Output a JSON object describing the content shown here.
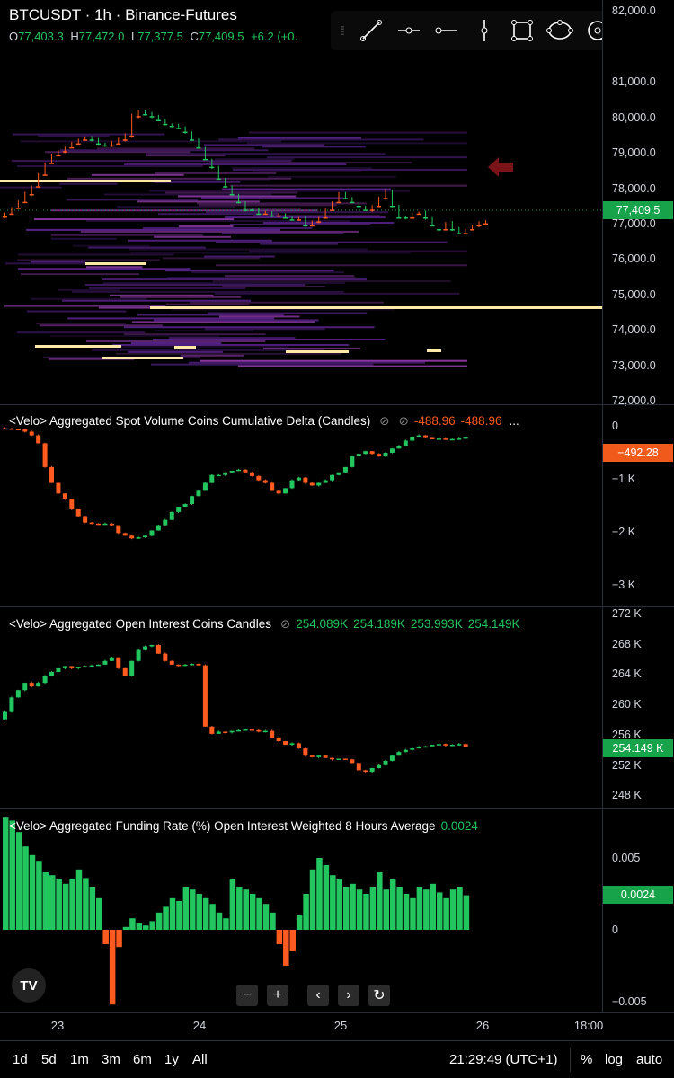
{
  "header": {
    "symbol": "BTCUSDT · 1h · Binance-Futures",
    "ohlc": {
      "o_label": "O",
      "o": "77,403.3",
      "h_label": "H",
      "h": "77,472.0",
      "l_label": "L",
      "l": "77,377.5",
      "c_label": "C",
      "c": "77,409.5",
      "change": "+6.2 (+0."
    }
  },
  "toolbar": {
    "tools": [
      "trend-line-icon",
      "horizontal-ray-icon",
      "horizontal-line-icon",
      "vertical-line-icon",
      "rectangle-icon",
      "ellipse-icon",
      "circle-target-icon",
      "back-arrow-icon"
    ]
  },
  "price_axis": {
    "ticks": [
      "82,000.0",
      "81,000.0",
      "80,000.0",
      "79,000.0",
      "78,000.0",
      "77,000.0",
      "76,000.0",
      "75,000.0",
      "74,000.0",
      "73,000.0",
      "72,000.0"
    ],
    "current": "77,409.5"
  },
  "cvd": {
    "label": "<Velo> Aggregated Spot Volume Coins Cumulative Delta (Candles)",
    "v1": "-488.96",
    "v2": "-488.96",
    "more": "...",
    "ticks": [
      "0",
      "−1 K",
      "−2 K",
      "−3 K"
    ],
    "current": "−492.28",
    "chart_data": {
      "type": "candlestick",
      "y_unit": "coins",
      "ylim": [
        -3200,
        200
      ],
      "closes": [
        -20,
        -30,
        -40,
        -80,
        -150,
        -300,
        -750,
        -1050,
        -1250,
        -1350,
        -1550,
        -1680,
        -1800,
        -1820,
        -1830,
        -1820,
        -1850,
        -2000,
        -2050,
        -2100,
        -2080,
        -2050,
        -1950,
        -1850,
        -1750,
        -1600,
        -1500,
        -1450,
        -1300,
        -1200,
        -1050,
        -900,
        -900,
        -850,
        -820,
        -800,
        -850,
        -920,
        -1000,
        -1050,
        -1200,
        -1250,
        -1150,
        -1000,
        -950,
        -1050,
        -1100,
        -1050,
        -1000,
        -900,
        -850,
        -750,
        -550,
        -500,
        -450,
        -500,
        -550,
        -480,
        -400,
        -350,
        -250,
        -180,
        -150,
        -200,
        -220,
        -210,
        -220,
        -220,
        -210,
        -190
      ]
    }
  },
  "oi": {
    "label": "<Velo> Aggregated Open Interest Coins Candles",
    "vals": [
      "254.089K",
      "254.189K",
      "253.993K",
      "254.149K"
    ],
    "ticks": [
      "272 K",
      "268 K",
      "264 K",
      "260 K",
      "256 K",
      "252 K",
      "248 K"
    ],
    "current": "254.149 K",
    "chart_data": {
      "type": "candlestick",
      "y_unit": "K coins",
      "ylim": [
        246,
        273
      ],
      "closes": [
        259,
        261,
        262,
        263,
        262.5,
        263,
        264,
        264.5,
        265,
        265.3,
        265,
        265.2,
        265.3,
        265.4,
        265.5,
        266,
        266.5,
        265,
        264,
        266,
        267.5,
        268,
        268.2,
        267,
        266,
        265.5,
        265.4,
        265.5,
        265.6,
        265.4,
        257,
        256,
        256.3,
        256.2,
        256.4,
        256.5,
        256.6,
        256.5,
        256.3,
        256.4,
        255.5,
        255,
        254.5,
        254.7,
        254,
        253,
        252.8,
        253,
        252.7,
        252.5,
        252.6,
        252.5,
        252,
        251,
        250.8,
        251.3,
        251.7,
        252.3,
        253,
        253.5,
        253.8,
        254,
        254.2,
        254.3,
        254.5,
        254.6,
        254.4,
        254.5,
        254.6,
        254.2
      ]
    }
  },
  "funding": {
    "label": "<Velo> Aggregated Funding Rate (%) Open Interest Weighted 8 Hours Average",
    "value": "0.0024",
    "ticks": [
      "0.005",
      "0",
      "−0.005"
    ],
    "current": "0.0024",
    "chart_data": {
      "type": "bar",
      "y_unit": "%",
      "ylim": [
        -0.0058,
        0.0085
      ],
      "values": [
        0.0078,
        0.0076,
        0.0068,
        0.0058,
        0.0052,
        0.0048,
        0.004,
        0.0038,
        0.0035,
        0.0032,
        0.0035,
        0.0042,
        0.0036,
        0.003,
        0.0022,
        -0.001,
        -0.0052,
        -0.0012,
        0.0002,
        0.0008,
        0.0005,
        0.0003,
        0.0006,
        0.0012,
        0.0016,
        0.0022,
        0.002,
        0.003,
        0.0028,
        0.0025,
        0.0022,
        0.0018,
        0.0012,
        0.0008,
        0.0035,
        0.003,
        0.0028,
        0.0025,
        0.0022,
        0.0018,
        0.0012,
        -0.001,
        -0.0025,
        -0.0015,
        0.001,
        0.0025,
        0.0042,
        0.005,
        0.0045,
        0.0038,
        0.0035,
        0.003,
        0.0032,
        0.0028,
        0.0025,
        0.003,
        0.004,
        0.0028,
        0.0035,
        0.003,
        0.0025,
        0.0022,
        0.003,
        0.0028,
        0.0032,
        0.0026,
        0.0022,
        0.0028,
        0.003,
        0.0024
      ]
    }
  },
  "time_axis": [
    "23",
    "24",
    "25",
    "26",
    "18:00"
  ],
  "controls": {
    "zoom_out": "−",
    "zoom_in": "+",
    "prev": "‹",
    "next": "›",
    "reset": "↻",
    "logo": "TV"
  },
  "bottom": {
    "ranges": [
      "1d",
      "5d",
      "1m",
      "3m",
      "6m",
      "1y",
      "All"
    ],
    "clock": "21:29:49 (UTC+1)",
    "pct": "%",
    "log": "log",
    "auto": "auto"
  },
  "colors": {
    "up": "#22c55e",
    "down": "#ff5a1f",
    "bg": "#000000",
    "heat": "#7a2fc0",
    "hot": "#ffe8a8"
  }
}
